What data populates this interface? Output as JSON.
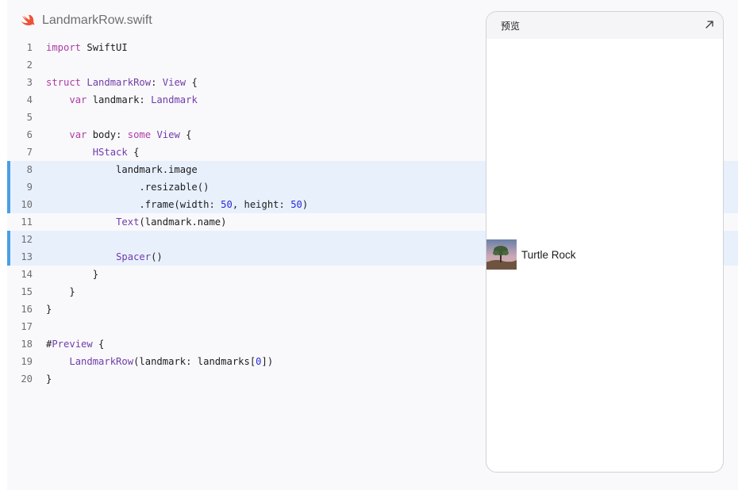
{
  "file": {
    "name": "LandmarkRow.swift",
    "icon": "swift-icon"
  },
  "code": {
    "highlighted_lines": [
      8,
      9,
      10,
      12,
      13
    ],
    "lines": [
      {
        "n": "1",
        "tokens": [
          [
            "kw",
            "import"
          ],
          [
            "plain",
            " SwiftUI"
          ]
        ]
      },
      {
        "n": "2",
        "tokens": []
      },
      {
        "n": "3",
        "tokens": [
          [
            "kw",
            "struct"
          ],
          [
            "plain",
            " "
          ],
          [
            "ty",
            "LandmarkRow"
          ],
          [
            "plain",
            ": "
          ],
          [
            "ty",
            "View"
          ],
          [
            "plain",
            " {"
          ]
        ]
      },
      {
        "n": "4",
        "tokens": [
          [
            "plain",
            "    "
          ],
          [
            "kw",
            "var"
          ],
          [
            "plain",
            " landmark: "
          ],
          [
            "ty",
            "Landmark"
          ]
        ]
      },
      {
        "n": "5",
        "tokens": []
      },
      {
        "n": "6",
        "tokens": [
          [
            "plain",
            "    "
          ],
          [
            "kw",
            "var"
          ],
          [
            "plain",
            " body: "
          ],
          [
            "kw",
            "some"
          ],
          [
            "plain",
            " "
          ],
          [
            "ty",
            "View"
          ],
          [
            "plain",
            " {"
          ]
        ]
      },
      {
        "n": "7",
        "tokens": [
          [
            "plain",
            "        "
          ],
          [
            "ty",
            "HStack"
          ],
          [
            "plain",
            " {"
          ]
        ]
      },
      {
        "n": "8",
        "tokens": [
          [
            "plain",
            "            landmark.image"
          ]
        ]
      },
      {
        "n": "9",
        "tokens": [
          [
            "plain",
            "                .resizable()"
          ]
        ]
      },
      {
        "n": "10",
        "tokens": [
          [
            "plain",
            "                .frame(width: "
          ],
          [
            "num",
            "50"
          ],
          [
            "plain",
            ", height: "
          ],
          [
            "num",
            "50"
          ],
          [
            "plain",
            ")"
          ]
        ]
      },
      {
        "n": "11",
        "tokens": [
          [
            "plain",
            "            "
          ],
          [
            "ty",
            "Text"
          ],
          [
            "plain",
            "(landmark.name)"
          ]
        ]
      },
      {
        "n": "12",
        "tokens": []
      },
      {
        "n": "13",
        "tokens": [
          [
            "plain",
            "            "
          ],
          [
            "ty",
            "Spacer"
          ],
          [
            "plain",
            "()"
          ]
        ]
      },
      {
        "n": "14",
        "tokens": [
          [
            "plain",
            "        }"
          ]
        ]
      },
      {
        "n": "15",
        "tokens": [
          [
            "plain",
            "    }"
          ]
        ]
      },
      {
        "n": "16",
        "tokens": [
          [
            "plain",
            "}"
          ]
        ]
      },
      {
        "n": "17",
        "tokens": []
      },
      {
        "n": "18",
        "tokens": [
          [
            "plain",
            "#"
          ],
          [
            "ty",
            "Preview"
          ],
          [
            "plain",
            " {"
          ]
        ]
      },
      {
        "n": "19",
        "tokens": [
          [
            "plain",
            "    "
          ],
          [
            "ty",
            "LandmarkRow"
          ],
          [
            "plain",
            "(landmark: landmarks["
          ],
          [
            "num",
            "0"
          ],
          [
            "plain",
            "])"
          ]
        ]
      },
      {
        "n": "20",
        "tokens": [
          [
            "plain",
            "}"
          ]
        ]
      }
    ]
  },
  "preview": {
    "title": "预览",
    "expand_icon": "expand-arrow-icon",
    "row_label": "Turtle Rock",
    "thumbnail": "landmark-thumbnail"
  },
  "colors": {
    "keyword": "#ad3da4",
    "type": "#703daa",
    "number": "#272ad8",
    "highlight_bg": "#e8f0fc",
    "highlight_bar": "#4a9fe3",
    "swift_orange": "#f05138"
  }
}
